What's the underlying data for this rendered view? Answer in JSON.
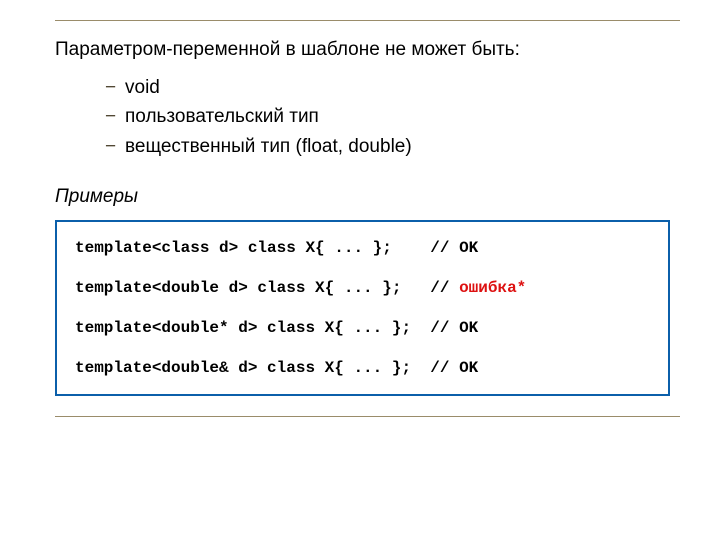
{
  "heading": "Параметром-переменной в шаблоне не может быть:",
  "bullets": [
    "void",
    "пользовательский тип",
    "вещественный тип (float, double)"
  ],
  "examples_label": "Примеры",
  "code": {
    "line1": "template<class d> class X{ ... };    // OK",
    "line2a": "template<double d> class X{ ... };   // ",
    "line2b": "ошибка*",
    "line3": "template<double* d> class X{ ... };  // OK",
    "line4": "template<double& d> class X{ ... };  // OK"
  }
}
